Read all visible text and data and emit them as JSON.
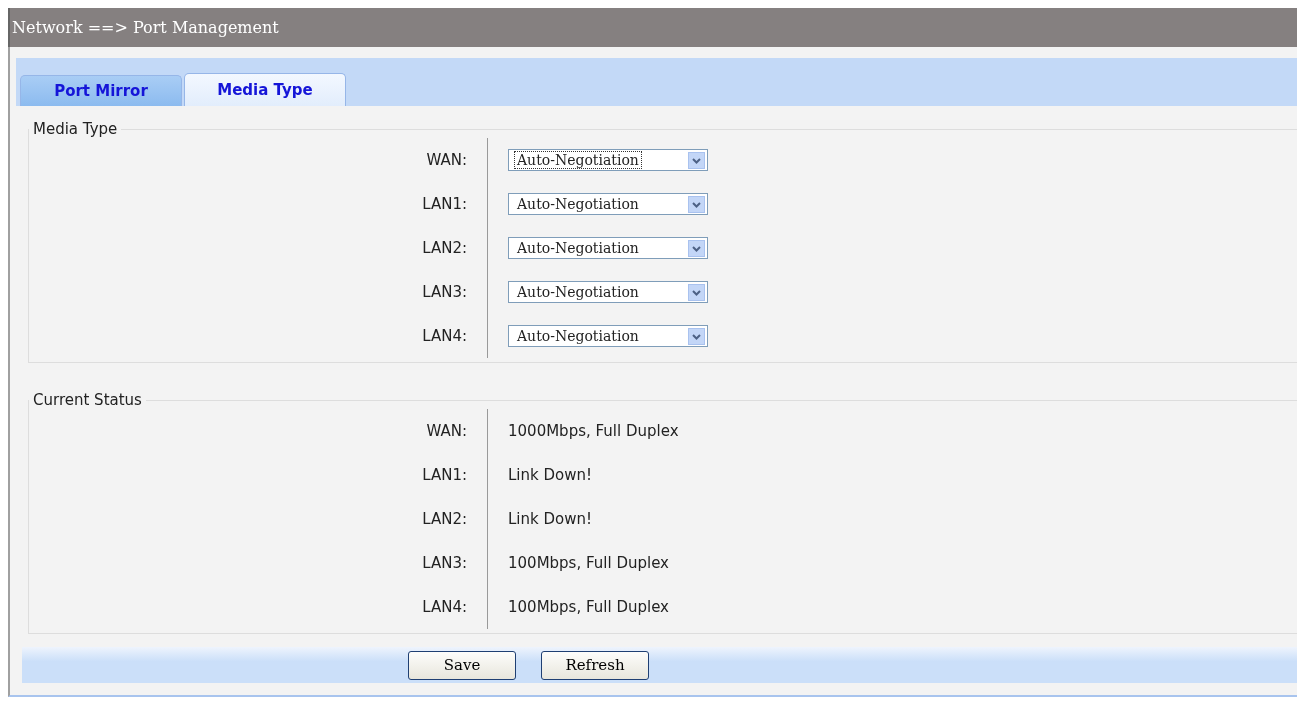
{
  "breadcrumb": "Network ==> Port Management",
  "tabs": [
    {
      "label": "Port Mirror",
      "selected": false
    },
    {
      "label": "Media Type",
      "selected": true
    }
  ],
  "media_type": {
    "legend": "Media Type",
    "rows": [
      {
        "label": "WAN:",
        "value": "Auto-Negotiation",
        "focused": true
      },
      {
        "label": "LAN1:",
        "value": "Auto-Negotiation",
        "focused": false
      },
      {
        "label": "LAN2:",
        "value": "Auto-Negotiation",
        "focused": false
      },
      {
        "label": "LAN3:",
        "value": "Auto-Negotiation",
        "focused": false
      },
      {
        "label": "LAN4:",
        "value": "Auto-Negotiation",
        "focused": false
      }
    ]
  },
  "current_status": {
    "legend": "Current Status",
    "rows": [
      {
        "label": "WAN:",
        "value": "1000Mbps, Full Duplex"
      },
      {
        "label": "LAN1:",
        "value": "Link Down!"
      },
      {
        "label": "LAN2:",
        "value": "Link Down!"
      },
      {
        "label": "LAN3:",
        "value": "100Mbps, Full Duplex"
      },
      {
        "label": "LAN4:",
        "value": "100Mbps, Full Duplex"
      }
    ]
  },
  "buttons": [
    "Save",
    "Refresh"
  ]
}
